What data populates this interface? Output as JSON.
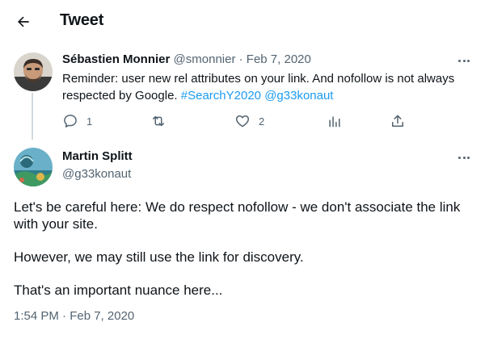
{
  "header": {
    "title": "Tweet",
    "back_icon": "arrow-left-icon"
  },
  "reply_tweet": {
    "author_name": "Sébastien Monnier",
    "handle": "@smonnier",
    "separator": "·",
    "date": "Feb 7, 2020",
    "text": "Reminder: user new rel attributes on your link. And nofollow is not always respected by Google.",
    "hashtag": "#SearchY2020",
    "mention": "@g33konaut",
    "actions": {
      "reply_count": "1",
      "retweet_count": "",
      "like_count": "2"
    }
  },
  "main_tweet": {
    "author_name": "Martin Splitt",
    "handle": "@g33konaut",
    "paragraphs": [
      "Let's be careful here: We do respect nofollow - we don't associate the link with your site.",
      "However, we may still use the link for discovery.",
      "That's an important nuance here..."
    ],
    "timestamp": "1:54 PM · Feb 7, 2020"
  },
  "colors": {
    "accent": "#1d9bf0",
    "muted": "#536471",
    "text": "#0f1419",
    "line": "#cfd9de"
  }
}
